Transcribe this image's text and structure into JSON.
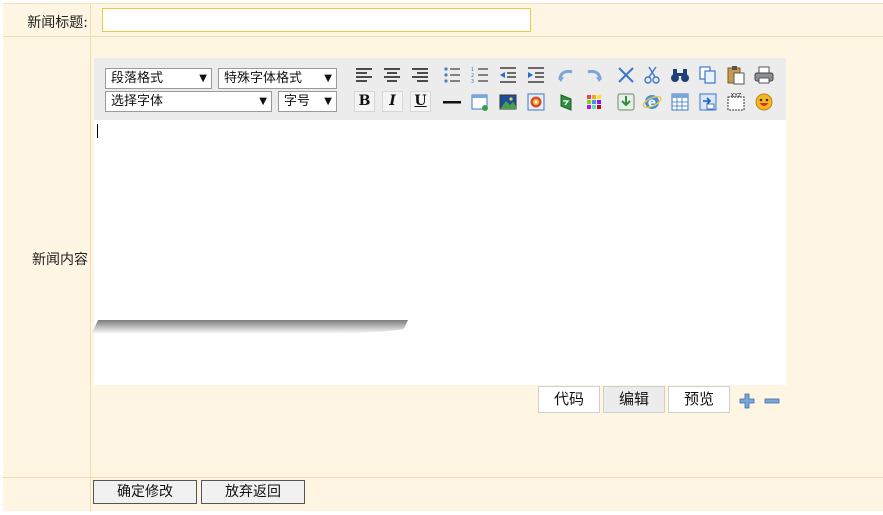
{
  "form": {
    "title_label": "新闻标题:",
    "title_value": "",
    "content_label": "新闻内容"
  },
  "toolbar": {
    "paragraph_select": "段落格式",
    "special_select": "特殊字体格式",
    "font_select": "选择字体",
    "size_select": "字号",
    "bold": "B",
    "italic": "I",
    "underline": "U",
    "arrow": "▼"
  },
  "editor_modes": {
    "code": "代码",
    "edit": "编辑",
    "preview": "预览",
    "active": "edit"
  },
  "actions": {
    "confirm": "确定修改",
    "cancel": "放弃返回"
  }
}
